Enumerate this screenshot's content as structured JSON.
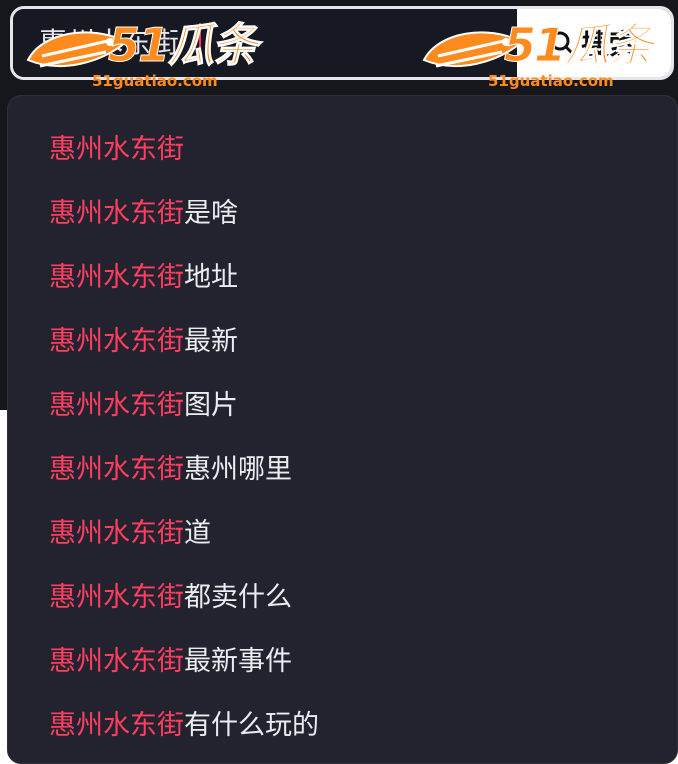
{
  "search": {
    "value": "惠州水东街",
    "button_label": "搜索"
  },
  "watermark": {
    "number": "51瓜条",
    "url": "51guatiao.com"
  },
  "suggestions": [
    {
      "highlight": "惠州水东街",
      "rest": ""
    },
    {
      "highlight": "惠州水东街",
      "rest": "是啥"
    },
    {
      "highlight": "惠州水东街",
      "rest": "地址"
    },
    {
      "highlight": "惠州水东街",
      "rest": "最新"
    },
    {
      "highlight": "惠州水东街",
      "rest": "图片"
    },
    {
      "highlight": "惠州水东街",
      "rest": "惠州哪里"
    },
    {
      "highlight": "惠州水东街",
      "rest": "道"
    },
    {
      "highlight": "惠州水东街",
      "rest": "都卖什么"
    },
    {
      "highlight": "惠州水东街",
      "rest": "最新事件"
    },
    {
      "highlight": "惠州水东街",
      "rest": "有什么玩的"
    }
  ],
  "colors": {
    "highlight": "#ff3e60",
    "dropdown_bg": "#23232f",
    "watermark": "#ff8a1d"
  }
}
